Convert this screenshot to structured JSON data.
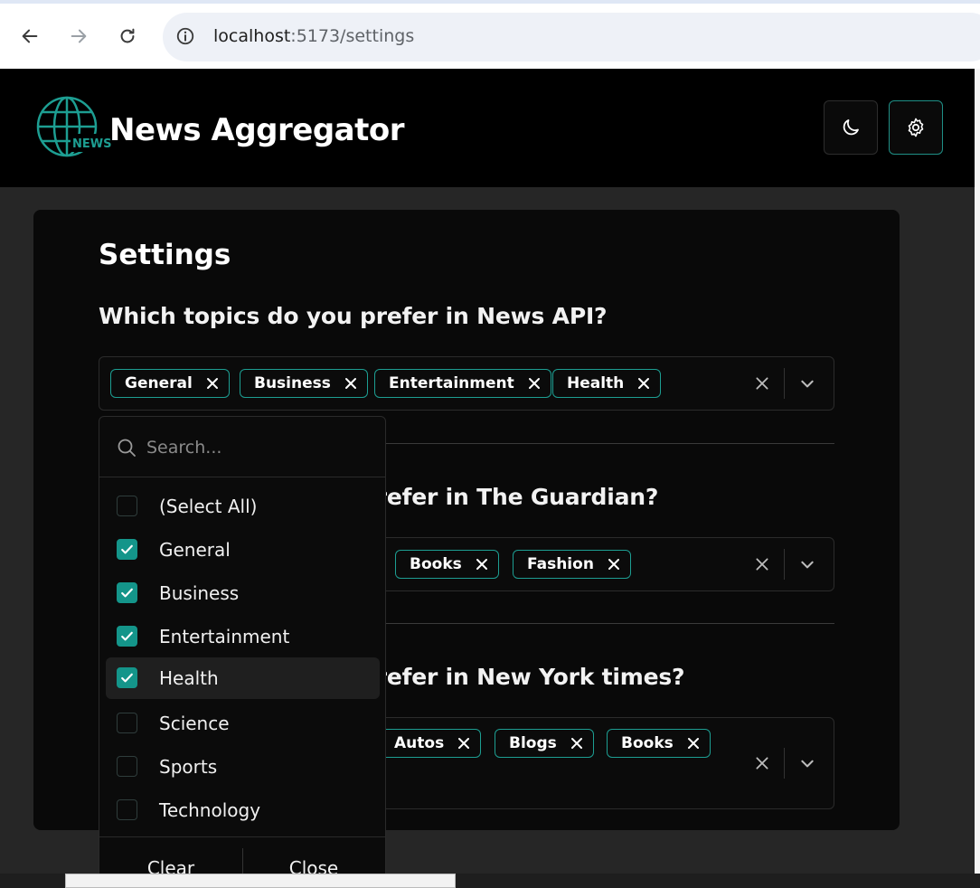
{
  "browser": {
    "url_host": "localhost",
    "url_rest": ":5173/settings"
  },
  "header": {
    "title": "News Aggregator",
    "logo_text": "NEWS"
  },
  "settings": {
    "title": "Settings",
    "sections": [
      {
        "question": "Which topics do you prefer in News API?",
        "tags": [
          "General",
          "Business",
          "Entertainment",
          "Health"
        ]
      },
      {
        "question": "Which topics do you prefer in The Guardian?",
        "tags": [
          "Books",
          "Fashion"
        ]
      },
      {
        "question": "Which topics do you prefer in New York times?",
        "tags": [
          "Autos",
          "Blogs",
          "Books"
        ]
      }
    ]
  },
  "dropdown": {
    "search_placeholder": "Search...",
    "items": [
      {
        "label": "(Select All)",
        "checked": false
      },
      {
        "label": "General",
        "checked": true
      },
      {
        "label": "Business",
        "checked": true
      },
      {
        "label": "Entertainment",
        "checked": true
      },
      {
        "label": "Health",
        "checked": true
      },
      {
        "label": "Science",
        "checked": false
      },
      {
        "label": "Sports",
        "checked": false
      },
      {
        "label": "Technology",
        "checked": false
      }
    ],
    "clear_label": "Clear",
    "close_label": "Close"
  },
  "colors": {
    "accent": "#14958a",
    "background": "#262626",
    "card": "#090909"
  },
  "icons": [
    "back-arrow-icon",
    "forward-arrow-icon",
    "reload-icon",
    "info-icon",
    "globe-icon",
    "moon-icon",
    "gear-icon",
    "close-icon",
    "chevron-down-icon",
    "search-icon",
    "check-icon"
  ]
}
